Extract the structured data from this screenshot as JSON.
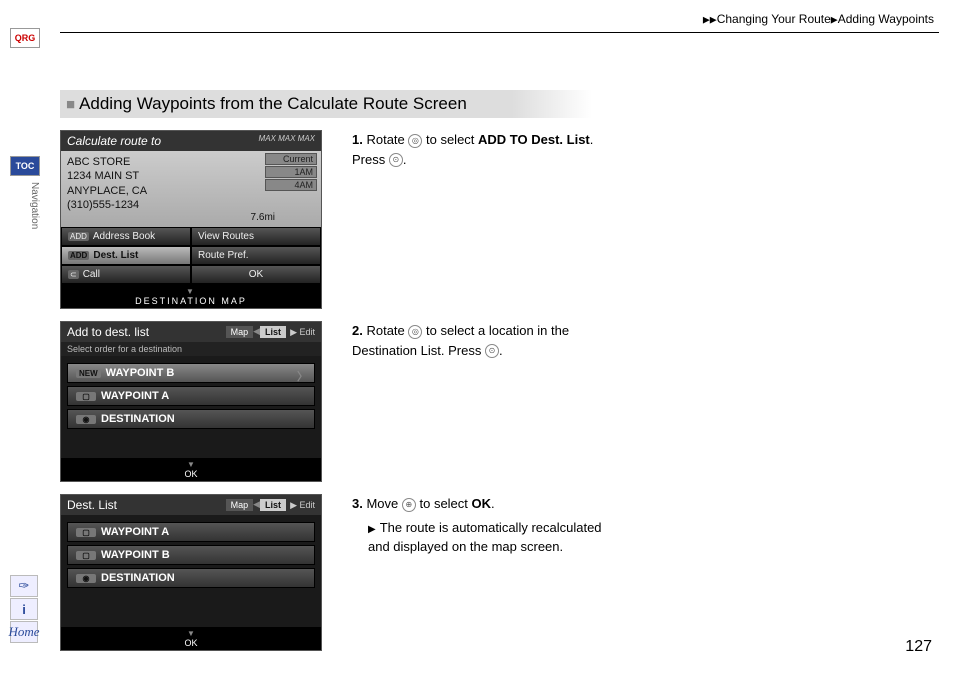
{
  "breadcrumb": {
    "a": "Changing Your Route",
    "b": "Adding Waypoints"
  },
  "sidebar": {
    "qrg": "QRG",
    "toc": "TOC",
    "nav": "Navigation",
    "home": "Home"
  },
  "heading": "Adding Waypoints from the Calculate Route Screen",
  "steps": {
    "s1a": "Rotate ",
    "s1b": " to select ",
    "s1bold": "ADD TO Dest. List",
    "s1c": ". Press ",
    "s2a": "Rotate ",
    "s2b": " to select a location in the Destination List. Press ",
    "s3a": "Move ",
    "s3b": " to select ",
    "s3bold": "OK",
    "s3c": ".",
    "s3note": "The route is automatically recalculated and displayed on the map screen."
  },
  "shot1": {
    "title": "Calculate route to",
    "max": "MAX   MAX   MAX",
    "addr1": "ABC STORE",
    "addr2": "1234 MAIN ST",
    "addr3": "ANYPLACE, CA",
    "phone": "(310)555-1234",
    "current": "Current",
    "t1": "1AM",
    "t2": "4AM",
    "dist": "7.6mi",
    "b1": "Address Book",
    "b2": "View Routes",
    "b3": "Dest. List",
    "b4": "Route Pref.",
    "b5": "Call",
    "b6": "OK",
    "foot": "DESTINATION MAP"
  },
  "shot2": {
    "title": "Add to dest. list",
    "tab1": "Map",
    "tab2": "List",
    "edit": "Edit",
    "sub": "Select order for a destination",
    "i1": "WAYPOINT B",
    "i1tag": "NEW",
    "i2": "WAYPOINT A",
    "i3": "DESTINATION",
    "foot": "OK"
  },
  "shot3": {
    "title": "Dest. List",
    "tab1": "Map",
    "tab2": "List",
    "edit": "Edit",
    "i1": "WAYPOINT A",
    "i2": "WAYPOINT B",
    "i3": "DESTINATION",
    "foot": "OK"
  },
  "page": "127"
}
